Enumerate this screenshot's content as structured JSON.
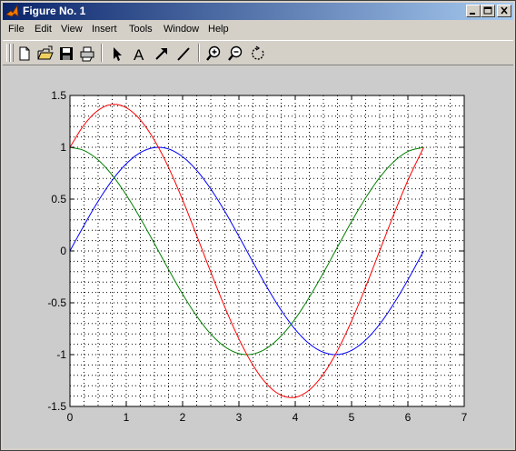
{
  "window": {
    "title": "Figure No. 1"
  },
  "menu": {
    "items": [
      "File",
      "Edit",
      "View",
      "Insert",
      "Tools",
      "Window",
      "Help"
    ]
  },
  "toolbar": {
    "icons": [
      "new-file-icon",
      "open-folder-icon",
      "save-icon",
      "print-icon",
      "arrow-pointer-icon",
      "text-tool-icon",
      "arrow-tool-icon",
      "line-tool-icon",
      "zoom-in-icon",
      "zoom-out-icon",
      "rotate-icon"
    ]
  },
  "colors": {
    "figure_background": "#cccccc",
    "axes_background": "#ffffff",
    "title_bar_start": "#0a246a",
    "title_bar_end": "#a6caf0"
  },
  "chart_data": {
    "type": "line",
    "title": "",
    "xlabel": "",
    "ylabel": "",
    "xlim": [
      0,
      7
    ],
    "ylim": [
      -1.5,
      1.5
    ],
    "xticks": [
      0,
      1,
      2,
      3,
      4,
      5,
      6,
      7
    ],
    "yticks": [
      -1.5,
      -1,
      -0.5,
      0,
      0.5,
      1,
      1.5
    ],
    "xtick_labels": [
      "0",
      "1",
      "2",
      "3",
      "4",
      "5",
      "6",
      "7"
    ],
    "ytick_labels": [
      "-1.5",
      "-1",
      "-0.5",
      "0",
      "0.5",
      "1",
      "1.5"
    ],
    "grid": "dotted minor grid",
    "series": [
      {
        "color": "#0000ff",
        "x": [
          0,
          0.25,
          0.5,
          0.75,
          1,
          1.25,
          1.5,
          1.75,
          2,
          2.25,
          2.5,
          2.75,
          3,
          3.25,
          3.5,
          3.75,
          4,
          4.25,
          4.5,
          4.75,
          5,
          5.25,
          5.5,
          5.75,
          6,
          6.28
        ],
        "y": [
          0,
          0.247,
          0.479,
          0.682,
          0.841,
          0.949,
          0.997,
          0.984,
          0.909,
          0.778,
          0.598,
          0.382,
          0.141,
          -0.108,
          -0.351,
          -0.572,
          -0.757,
          -0.895,
          -0.977,
          -0.999,
          -0.959,
          -0.859,
          -0.706,
          -0.508,
          -0.279,
          0
        ]
      },
      {
        "color": "#008000",
        "x": [
          0,
          0.25,
          0.5,
          0.75,
          1,
          1.25,
          1.5,
          1.75,
          2,
          2.25,
          2.5,
          2.75,
          3,
          3.25,
          3.5,
          3.75,
          4,
          4.25,
          4.5,
          4.75,
          5,
          5.25,
          5.5,
          5.75,
          6,
          6.28
        ],
        "y": [
          1,
          0.969,
          0.878,
          0.732,
          0.54,
          0.315,
          0.071,
          -0.178,
          -0.416,
          -0.628,
          -0.801,
          -0.924,
          -0.99,
          -0.994,
          -0.936,
          -0.82,
          -0.654,
          -0.446,
          -0.211,
          0.038,
          0.284,
          0.512,
          0.709,
          0.861,
          0.96,
          1
        ]
      },
      {
        "color": "#ff0000",
        "x": [
          0,
          0.25,
          0.5,
          0.75,
          1,
          1.25,
          1.5,
          1.75,
          2,
          2.25,
          2.5,
          2.75,
          3,
          3.25,
          3.5,
          3.75,
          4,
          4.25,
          4.5,
          4.75,
          5,
          5.25,
          5.5,
          5.75,
          6,
          6.28
        ],
        "y": [
          1,
          1.216,
          1.357,
          1.414,
          1.382,
          1.264,
          1.068,
          0.806,
          0.493,
          0.15,
          -0.203,
          -0.542,
          -0.849,
          -1.102,
          -1.287,
          -1.392,
          -1.411,
          -1.341,
          -1.188,
          -0.961,
          -0.675,
          -0.347,
          0.003,
          0.353,
          0.681,
          1
        ]
      }
    ]
  }
}
